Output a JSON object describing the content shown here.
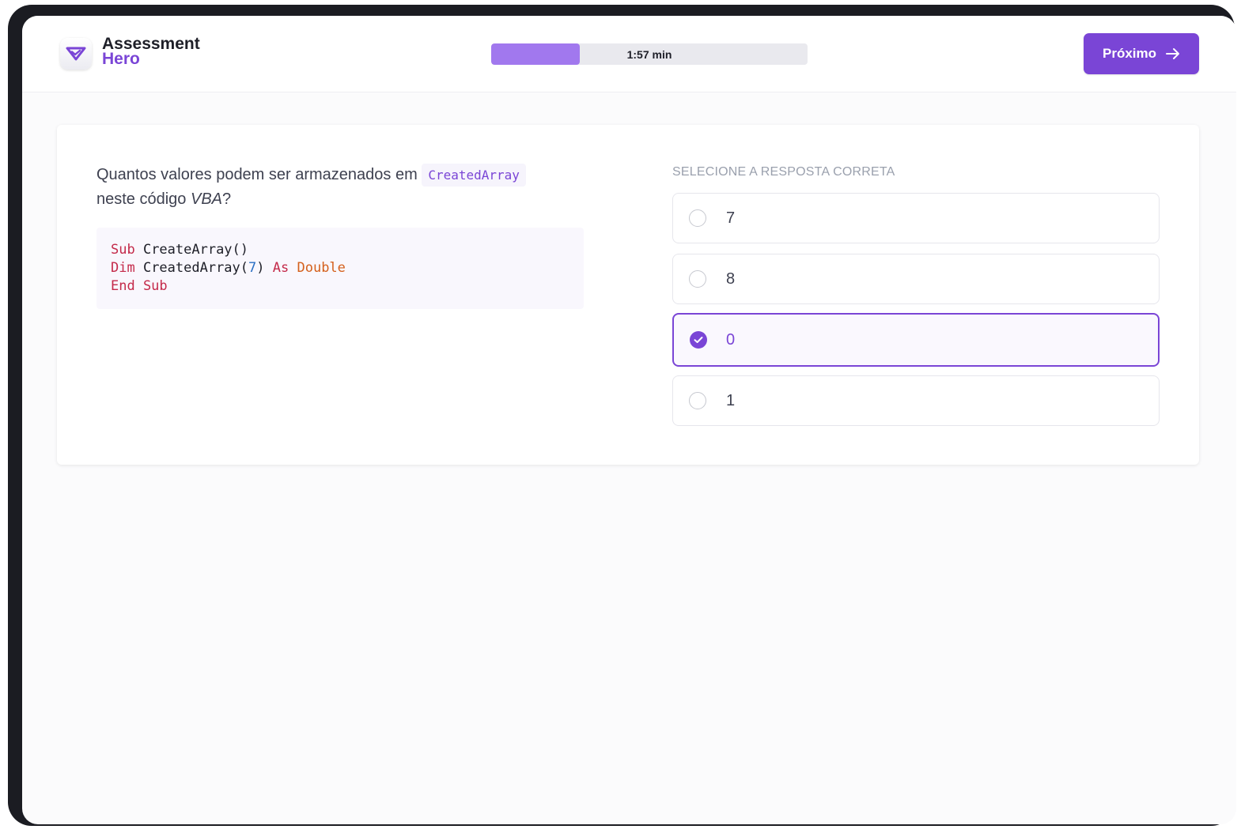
{
  "header": {
    "logo_line1": "Assessment",
    "logo_line2": "Hero",
    "timer_text": "1:57 min",
    "timer_progress": 0.28,
    "next_label": "Próximo"
  },
  "question": {
    "text_before": "Quantos valores podem ser armazenados em ",
    "inline_code": "CreatedArray",
    "text_line2": "neste código ",
    "lang": "VBA",
    "question_mark": "?"
  },
  "code": {
    "line1_kw": "Sub",
    "line1_rest": " CreateArray()",
    "line2_kw": "Dim",
    "line2_name": " CreatedArray(",
    "line2_num": "7",
    "line2_close": ") ",
    "line2_as": "As",
    "line2_type": "Double",
    "line3_kw": "End Sub"
  },
  "answers": {
    "label": "SELECIONE A RESPOSTA CORRETA",
    "options": [
      "7",
      "8",
      "0",
      "1"
    ],
    "selected_index": 2
  },
  "colors": {
    "accent": "#7a45d6",
    "timer_fill": "#a178ee",
    "keyword": "#c42a4a",
    "number": "#2a6fc4",
    "type": "#d4601c"
  }
}
